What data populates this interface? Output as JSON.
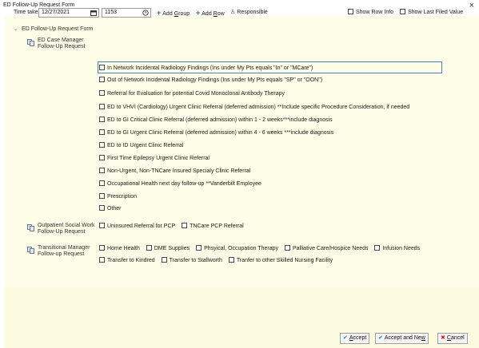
{
  "window": {
    "title": "ED Follow-Up Request Form",
    "close_glyph": "×"
  },
  "toolbar": {
    "time_taken_label": "Time taken:",
    "date_value": "12/27/2021",
    "time_value": "1153",
    "add_group": {
      "prefix": "Add ",
      "key": "G",
      "suffix": "roup"
    },
    "add_row": {
      "prefix": "Add ",
      "key": "R",
      "suffix": "ow"
    },
    "responsible": "Responsible",
    "show_row_info": "Show Row Info",
    "show_last_filed": "Show Last Filed Value"
  },
  "section": {
    "title": "ED Follow-Up Request Form"
  },
  "groups": [
    {
      "label_line1": "ED Case Manager",
      "label_line2": "Follow-Up Request",
      "options": [
        "In Network Incidental Radiology Findings (Ins under My Pts equals \"In\" or \"MCare\")",
        "Out of Network Incidental Radiology Findings (Ins under My Pts equals \"SP\" or \"OON\")",
        "Referral for Evaluation for potential Covid Monoclonal Antibody Therapy",
        "ED to VHVI (Cardiology) Urgent Clinic Referral (deferred admission) **Include specific Procedure Consideration, if needed",
        "ED to GI Critical Clinic Referral (deferred admission) within 1 - 2 weeks***include diagnosis",
        "ED to GI Urgent Clinic Referral (deferred admission) within 4 - 6 weeks ***include diagnosis",
        "ED to ID Urgent Clinic Referral",
        "First Time Epilepsy Urgent Clinic Referral",
        "Non-Urgent, Non-TNCare Insured Specialy Clinic Referral",
        "Occupational Health next day follow-up **Vanderbilt Employee",
        "Prescription",
        "Other"
      ]
    },
    {
      "label_line1": "Outpatient Social Work",
      "label_line2": "Follow-Up Request",
      "options": [
        "Uninsured Referral for PCP",
        "TNCare PCP Referral"
      ]
    },
    {
      "label_line1": "Transitional Manager",
      "label_line2": "Follow-up Request",
      "options_row1": [
        "Home Health",
        "DME Supplies",
        "Phsyical, Occupation Therapy",
        "Palliative Care/Hospice Needs",
        "Infusion Needs"
      ],
      "options_row2": [
        "Transfer to Kindred",
        "Transfer to Stallworth",
        "Tranfer to other Skilled Nursing Facility"
      ]
    }
  ],
  "footer": {
    "accept": {
      "key": "A",
      "rest": "ccept"
    },
    "accept_new": {
      "prefix": "Accept and Ne",
      "key": "w"
    },
    "cancel": {
      "key": "C",
      "rest": "ancel"
    }
  },
  "colors": {
    "client_background": "#fefde8",
    "accent_blue": "#1d7fd2",
    "add_green": "#1e8a1e",
    "cancel_red": "#cc2222",
    "focus_border": "#4a7fc1"
  },
  "icons": {
    "calendar": "calendar-icon",
    "clock": "clock-icon",
    "add": "plus-icon",
    "responsible": "person-icon",
    "group": "group-form-icon",
    "accept": "checkmark-icon",
    "cancel": "x-icon"
  }
}
